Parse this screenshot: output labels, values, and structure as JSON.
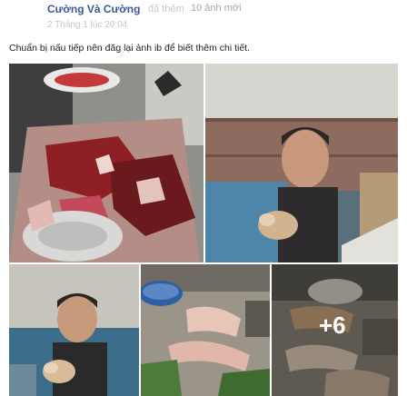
{
  "post": {
    "author": "Cường Và Cường",
    "action_text": "đã thêm",
    "photo_count": "10 ảnh mới",
    "timestamp": "2 Tháng 1 lúc 20:04",
    "caption": "Chuẩn bị nấu tiếp nên đăg lại ảnh ib để biết thêm chi tiết."
  },
  "photos": {
    "more_label": "+6"
  }
}
